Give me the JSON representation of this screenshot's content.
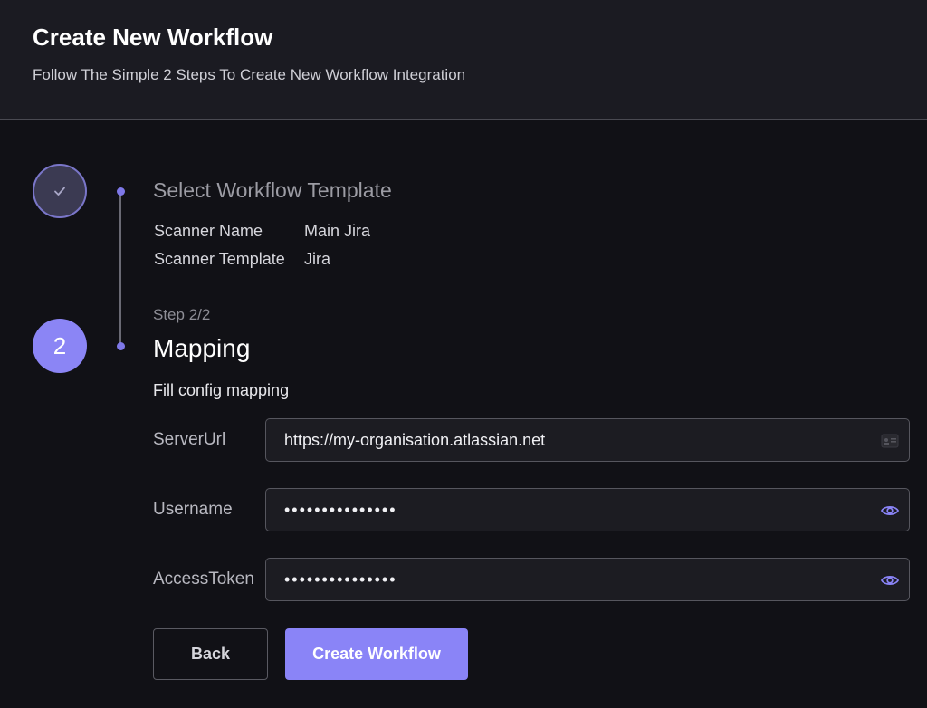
{
  "header": {
    "title": "Create New Workflow",
    "subtitle": "Follow The Simple 2 Steps To Create New Workflow Integration"
  },
  "steps": {
    "active_number": "2",
    "step1": {
      "title": "Select Workflow Template",
      "summary": [
        {
          "label": "Scanner Name",
          "value": "Main Jira"
        },
        {
          "label": "Scanner Template",
          "value": "Jira"
        }
      ]
    },
    "step2": {
      "counter": "Step 2/2",
      "title": "Mapping",
      "description": "Fill config mapping"
    }
  },
  "form": {
    "fields": [
      {
        "label": "ServerUrl",
        "value": "https://my-organisation.atlassian.net",
        "icon": "contact-card-icon"
      },
      {
        "label": "Username",
        "value": "•••••••••••••••",
        "icon": "eye-icon"
      },
      {
        "label": "AccessToken",
        "value": "•••••••••••••••",
        "icon": "eye-icon"
      }
    ]
  },
  "buttons": {
    "back": "Back",
    "create": "Create Workflow"
  },
  "colors": {
    "accent": "#8a84f7",
    "background": "#111116",
    "header_bg": "#1b1b22"
  }
}
